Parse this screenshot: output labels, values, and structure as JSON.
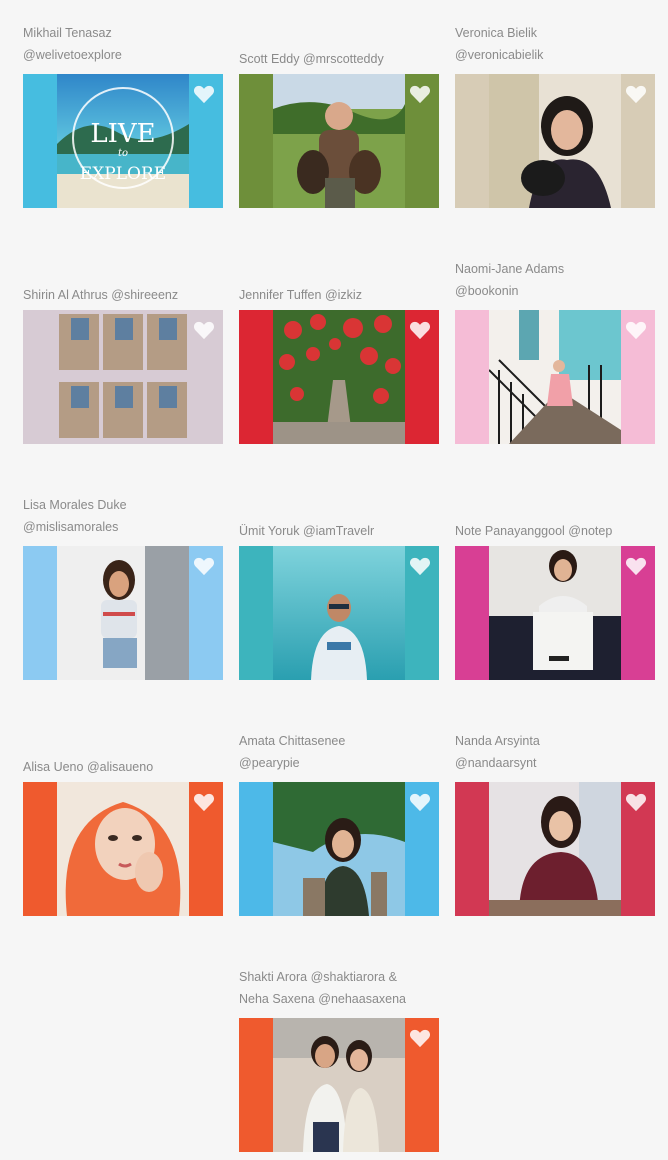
{
  "influencers": [
    {
      "name": "Mikhail Tenasaz",
      "handle": "@welivetoexplore",
      "accent": "#46bde0",
      "photo": {
        "kind": "logo",
        "words": [
          "LIVE",
          "to",
          "EXPLORE"
        ]
      }
    },
    {
      "name": "Scott Eddy",
      "handle": "@mrscotteddy",
      "accent": "#6e8f3a",
      "photo": {
        "kind": "person"
      }
    },
    {
      "name": "Veronica Bielik",
      "handle": "@veronicabielik",
      "accent": "#d7ccb6",
      "photo": {
        "kind": "person"
      }
    },
    {
      "name": "Shirin Al Athrus",
      "handle": "@shireeenz",
      "accent": "#d7cbd4",
      "photo": {
        "kind": "collage"
      }
    },
    {
      "name": "Jennifer Tuffen",
      "handle": "@izkiz",
      "accent": "#dc2633",
      "photo": {
        "kind": "garden"
      }
    },
    {
      "name": "Naomi-Jane Adams",
      "handle": "@bookonin",
      "accent": "#f5bcd6",
      "photo": {
        "kind": "stairs"
      }
    },
    {
      "name": "Lisa Morales Duke",
      "handle": "@mislisamorales",
      "accent": "#8ccaf2",
      "photo": {
        "kind": "person"
      }
    },
    {
      "name": "Ümit Yoruk",
      "handle": "@iamTravelr",
      "accent": "#3db4bd",
      "photo": {
        "kind": "sea"
      }
    },
    {
      "name": "Note Panayanggool",
      "handle": "@notep",
      "accent": "#d83f94",
      "photo": {
        "kind": "person"
      }
    },
    {
      "name": "Alisa Ueno",
      "handle": "@alisaueno",
      "accent": "#ef5a2e",
      "photo": {
        "kind": "portrait"
      }
    },
    {
      "name": "Amata Chittasenee",
      "handle": "@pearypie",
      "accent": "#4db9e8",
      "photo": {
        "kind": "person"
      }
    },
    {
      "name": "Nanda Arsyinta",
      "handle": "@nandaarsynt",
      "accent": "#d23853",
      "photo": {
        "kind": "person"
      }
    },
    {
      "name": "Shakti Arora",
      "handle": "@shaktiarora",
      "partner_name": "Neha Saxena",
      "partner_handle": "@nehaasaxena",
      "accent": "#ef5a2e",
      "photo": {
        "kind": "couple"
      }
    }
  ],
  "connector": "&",
  "heart_icon": "heart-icon",
  "colors": {
    "caption": "#8a8a8a",
    "background": "#f6f6f6",
    "heart": "#ffffff"
  }
}
